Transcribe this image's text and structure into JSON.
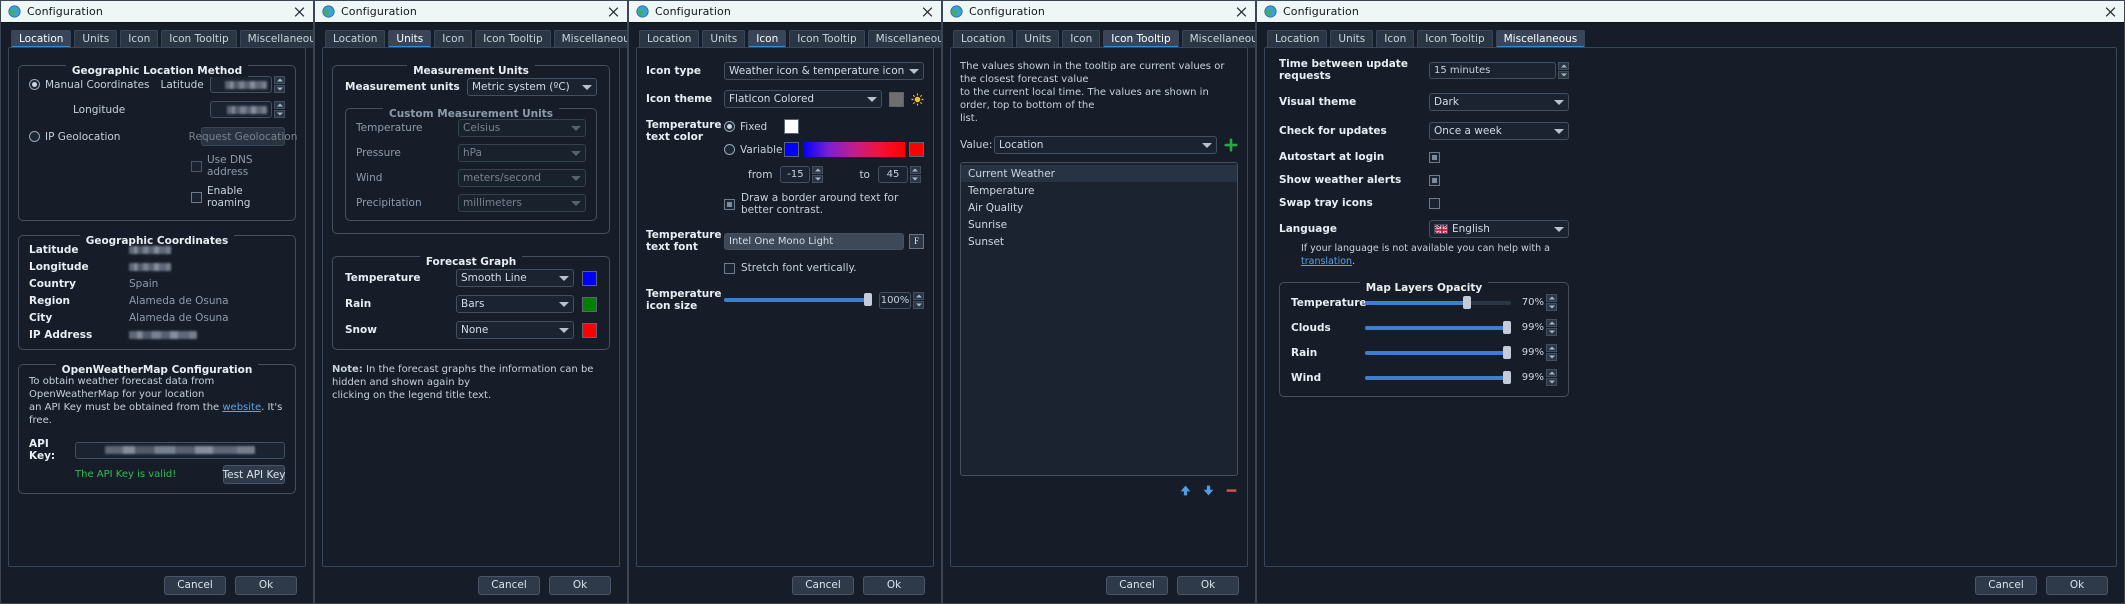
{
  "window_title": "Configuration",
  "tabs": [
    "Location",
    "Units",
    "Icon",
    "Icon Tooltip",
    "Miscellaneous"
  ],
  "buttons": {
    "cancel": "Cancel",
    "ok": "Ok"
  },
  "panel1": {
    "active_tab": "Location",
    "group_location_method": "Geographic Location Method",
    "manual_coordinates": "Manual Coordinates",
    "latitude_label": "Latitude",
    "longitude_label": "Longitude",
    "ip_geolocation": "IP Geolocation",
    "request_geolocation": "Request Geolocation",
    "use_dns_address": "Use DNS address",
    "enable_roaming": "Enable roaming",
    "group_coordinates": "Geographic Coordinates",
    "coords": [
      {
        "label": "Latitude",
        "value": "",
        "blurred": true
      },
      {
        "label": "Longitude",
        "value": "",
        "blurred": true
      },
      {
        "label": "Country",
        "value": "Spain",
        "blurred": false
      },
      {
        "label": "Region",
        "value": "Alameda de Osuna",
        "blurred": false
      },
      {
        "label": "City",
        "value": "Alameda de Osuna",
        "blurred": false
      },
      {
        "label": "IP Address",
        "value": "",
        "blurred": true
      }
    ],
    "group_owm": "OpenWeatherMap Configuration",
    "owm_note_1": "To obtain weather forecast data from OpenWeatherMap for your location",
    "owm_note_2a": "an API Key must be obtained from the ",
    "owm_note_link": "website",
    "owm_note_2b": ". It's free.",
    "api_key_label": "API Key:",
    "api_key_valid": "The API Key is valid!",
    "test_api_key": "Test API Key"
  },
  "panel2": {
    "active_tab": "Units",
    "group_measurement": "Measurement Units",
    "measurement_units_label": "Measurement units",
    "measurement_units_value": "Metric system (ºC)",
    "group_custom": "Custom Measurement Units",
    "custom": [
      {
        "label": "Temperature",
        "value": "Celsius"
      },
      {
        "label": "Pressure",
        "value": "hPa"
      },
      {
        "label": "Wind",
        "value": "meters/second"
      },
      {
        "label": "Precipitation",
        "value": "millimeters"
      }
    ],
    "group_forecast": "Forecast Graph",
    "forecast": [
      {
        "label": "Temperature",
        "value": "Smooth Line",
        "color": "#0000ff"
      },
      {
        "label": "Rain",
        "value": "Bars",
        "color": "#008000"
      },
      {
        "label": "Snow",
        "value": "None",
        "color": "#ff0000"
      }
    ],
    "note_bold": "Note:",
    "note_text_1": " In the forecast graphs the information can be hidden and shown again by",
    "note_text_2": "clicking on the legend title text."
  },
  "panel3": {
    "active_tab": "Icon",
    "icon_type_label": "Icon type",
    "icon_type_value": "Weather icon & temperature icon",
    "icon_theme_label": "Icon theme",
    "icon_theme_value": "FlatIcon Colored",
    "theme_swatch": "#6e6e6e",
    "temp_text_color_label": "Temperature text color",
    "fixed_label": "Fixed",
    "fixed_color": "#ffffff",
    "variable_label": "Variable",
    "variable_start_color": "#0000ff",
    "variable_end_color": "#ff0000",
    "from_label": "from",
    "from_value": "-15",
    "to_label": "to",
    "to_value": "45",
    "draw_border_label": "Draw a border around text for better contrast.",
    "temp_text_font_label": "Temperature text font",
    "temp_text_font_value": "Intel One Mono Light",
    "stretch_font_label": "Stretch font vertically.",
    "temp_icon_size_label": "Temperature icon size",
    "temp_icon_size_value": "100%"
  },
  "panel4": {
    "active_tab": "Icon Tooltip",
    "description_1": "The values shown in the tooltip are current values or the closest forecast value",
    "description_2": "to the current local time. The values are shown in order, top to bottom of the",
    "description_3": "list.",
    "value_label": "Value:",
    "value_selected": "Location",
    "list_items": [
      "Current Weather",
      "Temperature",
      "Air Quality",
      "Sunrise",
      "Sunset"
    ],
    "selected_index": 0
  },
  "panel5": {
    "active_tab": "Miscellaneous",
    "settings": [
      {
        "label": "Time between update requests",
        "value": "15 minutes",
        "type": "spin"
      },
      {
        "label": "Visual theme",
        "value": "Dark",
        "type": "combo"
      },
      {
        "label": "Check for updates",
        "value": "Once a week",
        "type": "combo"
      }
    ],
    "autostart_label": "Autostart at login",
    "autostart_checked": true,
    "show_alerts_label": "Show weather alerts",
    "show_alerts_checked": true,
    "swap_tray_label": "Swap tray icons",
    "swap_tray_checked": false,
    "language_label": "Language",
    "language_value": "English",
    "help_note_a": "If your language is not available you can help with a ",
    "help_note_link": "translation",
    "help_note_b": ".",
    "group_opacity": "Map Layers Opacity",
    "opacity": [
      {
        "label": "Temperature",
        "value": "70%",
        "pct": 70
      },
      {
        "label": "Clouds",
        "value": "99%",
        "pct": 99
      },
      {
        "label": "Rain",
        "value": "99%",
        "pct": 99
      },
      {
        "label": "Wind",
        "value": "99%",
        "pct": 99
      }
    ]
  }
}
